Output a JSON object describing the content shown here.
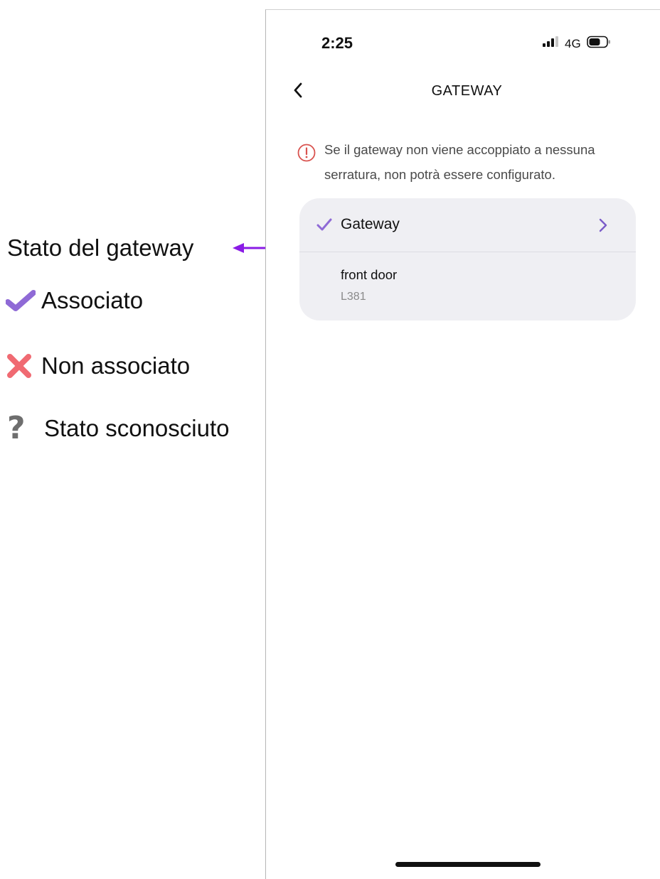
{
  "annotation": {
    "title": "Stato del gateway",
    "arrow_color": "#8a1be6",
    "legend": [
      {
        "icon": "check-icon",
        "label": "Associato",
        "color": "#8f6ad6"
      },
      {
        "icon": "cross-icon",
        "label": "Non associato",
        "color": "#f06a72"
      },
      {
        "icon": "question-icon",
        "label": "Stato sconosciuto",
        "color": "#6e6e6e"
      }
    ]
  },
  "status_bar": {
    "time": "2:25",
    "network": "4G"
  },
  "nav": {
    "back_icon": "chevron-left-icon",
    "title": "GATEWAY"
  },
  "warning": {
    "icon": "alert-circle-icon",
    "color": "#d9534f",
    "line1": "Se il gateway non viene accoppiato a nessuna",
    "line2": "serratura, non potrà essere configurato."
  },
  "gateway_card": {
    "status_icon": "check-icon",
    "status_color": "#8f6ad6",
    "label": "Gateway",
    "chevron_icon": "chevron-right-icon",
    "item_name": "front door",
    "item_id": "L381"
  }
}
